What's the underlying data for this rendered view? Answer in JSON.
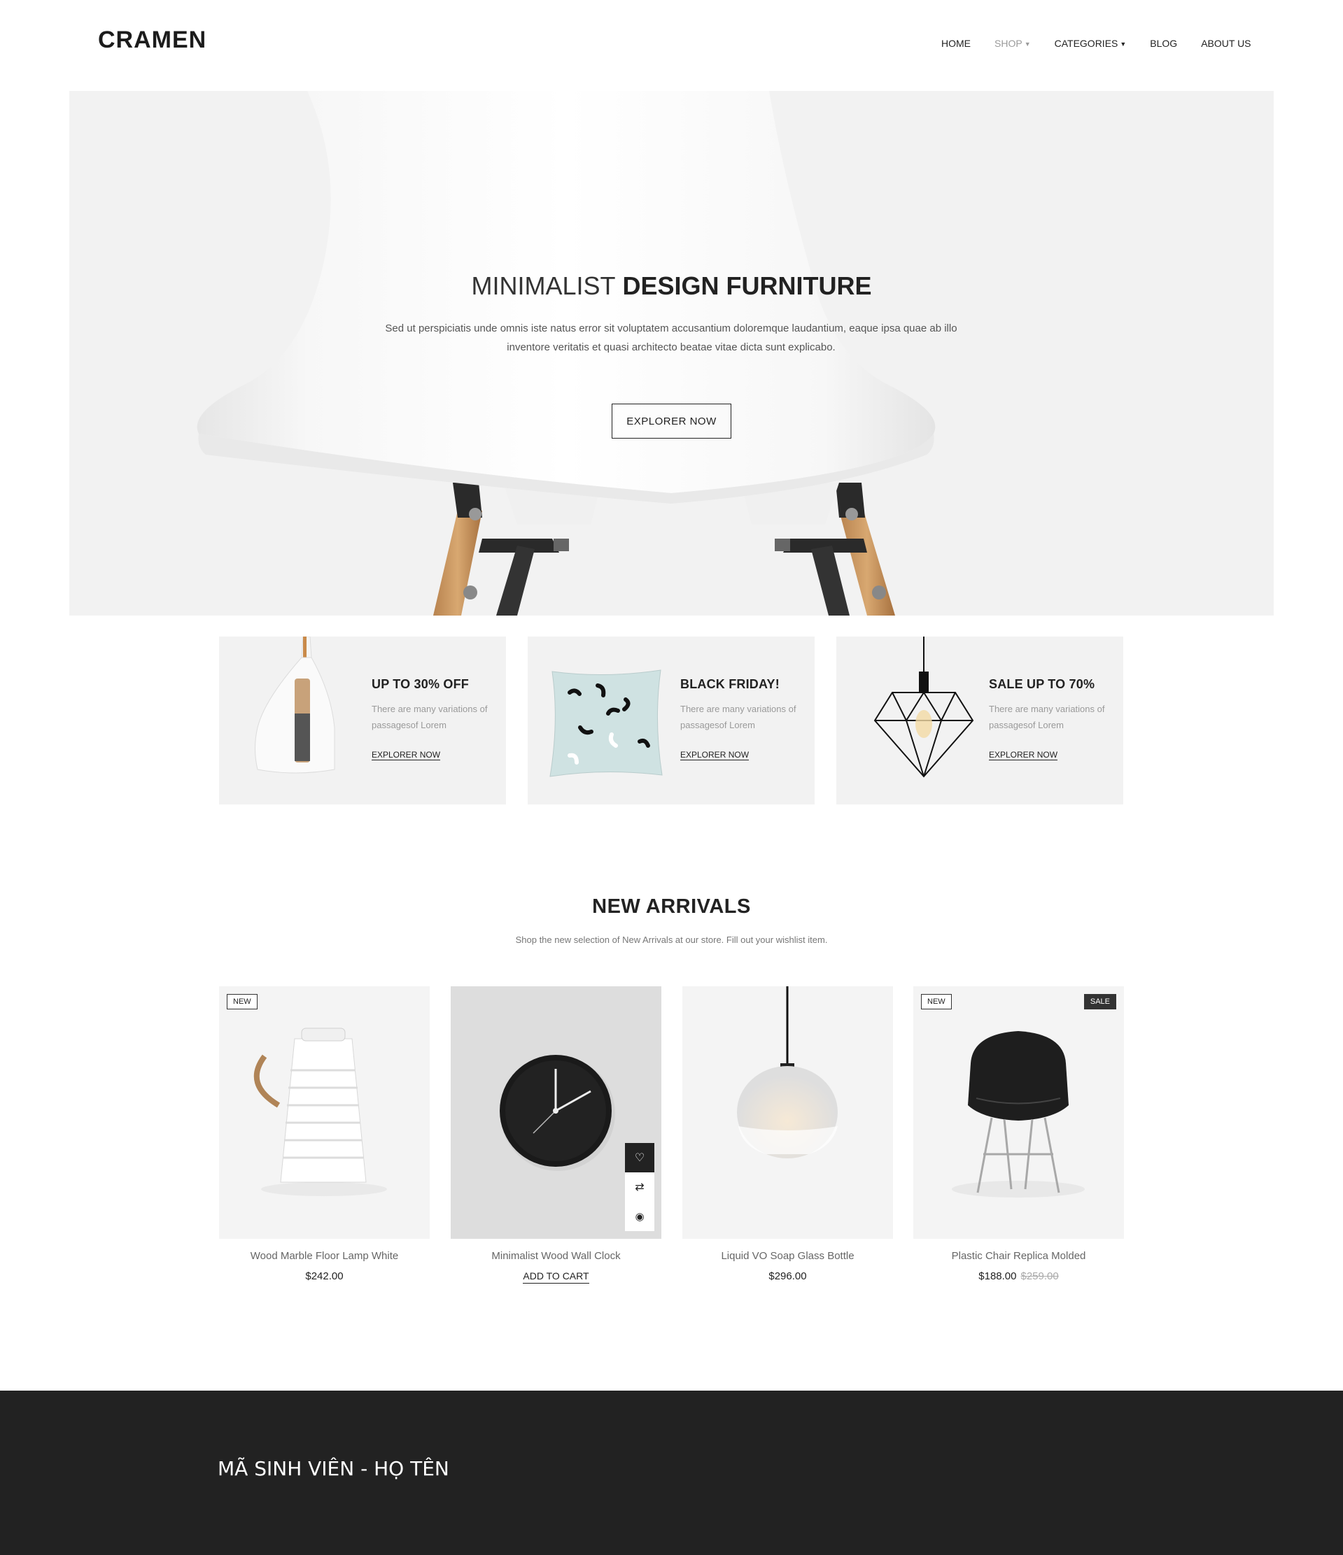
{
  "header": {
    "logo": "CRAMEN",
    "nav": [
      {
        "label": "HOME",
        "has_caret": false,
        "muted": false
      },
      {
        "label": "SHOP",
        "has_caret": true,
        "muted": true
      },
      {
        "label": "CATEGORIES",
        "has_caret": true,
        "muted": false
      },
      {
        "label": "BLOG",
        "has_caret": false,
        "muted": false
      },
      {
        "label": "ABOUT US",
        "has_caret": false,
        "muted": false
      }
    ]
  },
  "hero": {
    "title_light": "MINIMALIST",
    "title_bold": "DESIGN FURNITURE",
    "description": "Sed ut perspiciatis unde omnis iste natus error sit voluptatem accusantium doloremque laudantium,  eaque ipsa quae ab illo inventore veritatis et quasi architecto beatae vitae dicta sunt explicabo.",
    "button": "EXPLORER NOW",
    "background_color": "#f2f2f2"
  },
  "promos": [
    {
      "title": "UP TO 30% OFF",
      "desc": "There are many variations of passagesof Lorem",
      "link": "EXPLORER NOW",
      "icon": "dustpan-brush-image"
    },
    {
      "title": "BLACK FRIDAY!",
      "desc": "There are many variations of passagesof Lorem",
      "link": "EXPLORER NOW",
      "icon": "pillow-image"
    },
    {
      "title": "SALE UP TO 70%",
      "desc": "There are many variations of passagesof Lorem",
      "link": "EXPLORER NOW",
      "icon": "wire-pendant-lamp-image"
    }
  ],
  "new_arrivals": {
    "title": "NEW ARRIVALS",
    "subtitle": "Shop the new selection of New Arrivals at our store. Fill out your wishlist item."
  },
  "products": [
    {
      "name": "Wood Marble Floor Lamp White",
      "price": "$242.00",
      "badge_new": "NEW",
      "image": "white-lantern-image"
    },
    {
      "name": "Minimalist Wood Wall Clock",
      "cart": "ADD TO CART",
      "image": "wall-clock-image",
      "actions": [
        "heart-icon",
        "compare-icon",
        "eye-icon"
      ]
    },
    {
      "name": "Liquid VO Soap Glass Bottle",
      "price": "$296.00",
      "image": "glass-pendant-lamp-image"
    },
    {
      "name": "Plastic Chair Replica Molded",
      "price": "$188.00",
      "old_price": "$259.00",
      "badge_new": "NEW",
      "badge_sale": "SALE",
      "image": "black-chair-image"
    }
  ],
  "footer": {
    "text": "MÃ SINH VIÊN - HỌ TÊN",
    "background_color": "#222222"
  }
}
